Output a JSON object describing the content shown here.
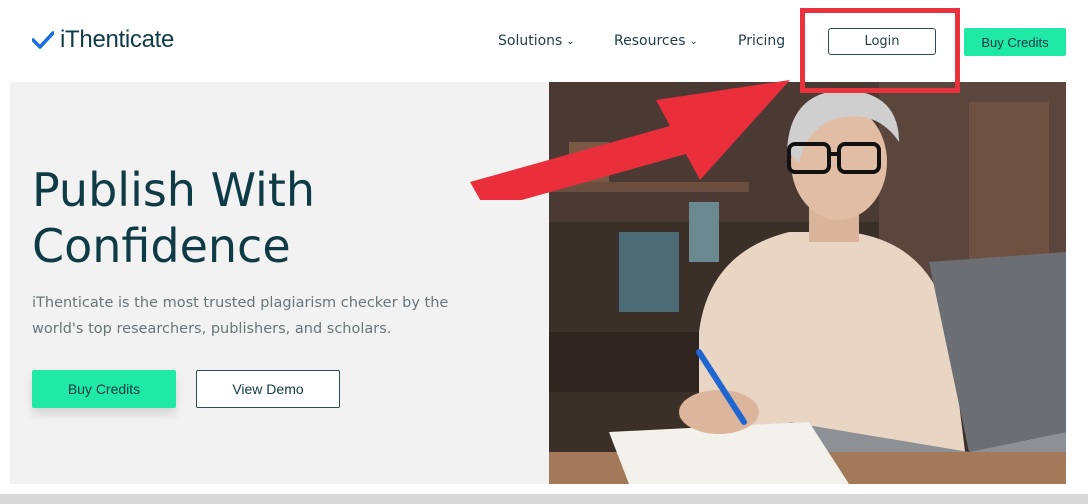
{
  "header": {
    "logo_text": "iThenticate",
    "nav": {
      "solutions": "Solutions",
      "resources": "Resources",
      "pricing": "Pricing"
    },
    "login_label": "Login",
    "buy_credits_label": "Buy Credits"
  },
  "hero": {
    "title": "Publish With Confidence",
    "description": "iThenticate is the most trusted plagiarism checker by the world's top researchers, publishers, and scholars.",
    "buy_credits_label": "Buy Credits",
    "view_demo_label": "View Demo"
  },
  "colors": {
    "accent_green": "#20e8a5",
    "brand_dark": "#0f3b46",
    "annotation_red": "#e8323d"
  },
  "icons": {
    "logo": "checkmark-icon",
    "dropdown": "chevron-down-icon"
  }
}
